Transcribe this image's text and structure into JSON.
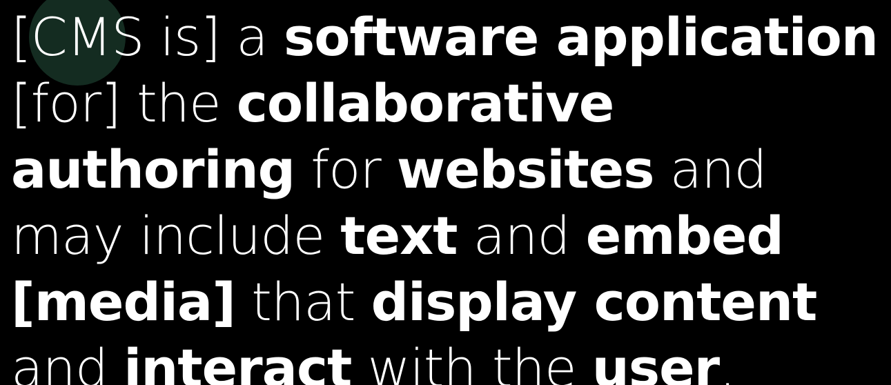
{
  "quote": {
    "lines": [
      [
        {
          "text": "[CMS is] a ",
          "bold": false
        },
        {
          "text": "software application",
          "bold": true
        }
      ],
      [
        {
          "text": "[for] the ",
          "bold": false
        },
        {
          "text": "collaborative",
          "bold": true
        }
      ],
      [
        {
          "text": "authoring",
          "bold": true
        },
        {
          "text": " for ",
          "bold": false
        },
        {
          "text": "websites",
          "bold": true
        },
        {
          "text": " and",
          "bold": false
        }
      ],
      [
        {
          "text": "may include ",
          "bold": false
        },
        {
          "text": "text",
          "bold": true
        },
        {
          "text": " and ",
          "bold": false
        },
        {
          "text": "embed",
          "bold": true
        }
      ],
      [
        {
          "text": "[media]",
          "bold": true
        },
        {
          "text": " that ",
          "bold": false
        },
        {
          "text": "display content",
          "bold": true
        }
      ],
      [
        {
          "text": "and ",
          "bold": false
        },
        {
          "text": "interact",
          "bold": true
        },
        {
          "text": " with the ",
          "bold": false
        },
        {
          "text": "user",
          "bold": true
        },
        {
          "text": ".",
          "bold": false
        }
      ]
    ]
  },
  "colors": {
    "background": "#000000",
    "text": "#ffffff",
    "cursor_highlight": "#163024"
  }
}
